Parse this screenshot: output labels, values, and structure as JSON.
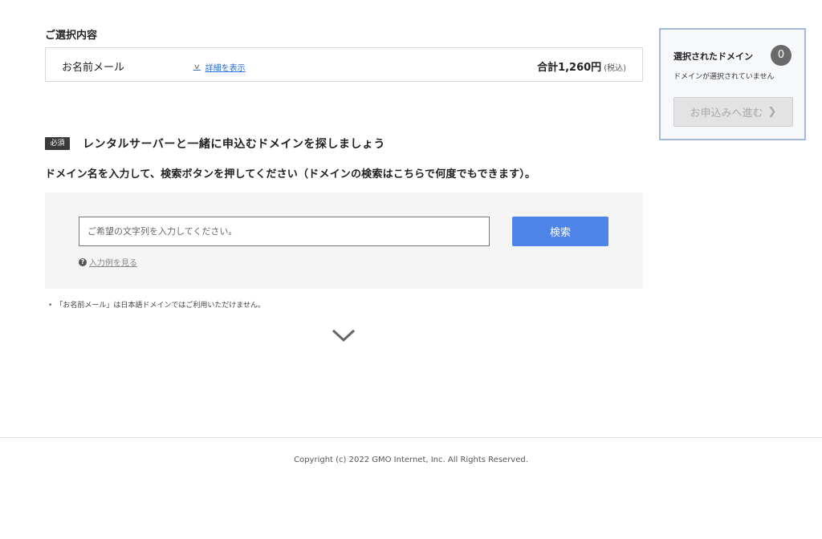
{
  "selection": {
    "title": "ご選択内容",
    "plan_name": "お名前メール",
    "details_link": "詳細を表示",
    "total_label": "合計1,260円",
    "tax_note": "(税込)"
  },
  "domain_section": {
    "required_badge": "必須",
    "heading": "レンタルサーバーと一緒に申込むドメインを探しましょう",
    "instruction": "ドメイン名を入力して、検索ボタンを押してください（ドメインの検索はこちらで何度でもできます）。",
    "search": {
      "placeholder": "ご希望の文字列を入力してください。",
      "value": "",
      "button_label": "検索"
    },
    "example_link": "入力例を見る",
    "note": "「お名前メール」は日本語ドメインではご利用いただけません。"
  },
  "side_panel": {
    "title": "選択されたドメイン",
    "count": "0",
    "status": "ドメインが選択されていません",
    "proceed_label": "お申込みへ進む",
    "proceed_arrow": "❯"
  },
  "footer": {
    "copyright": "Copyright (c) 2022 GMO Internet, Inc. All Rights Reserved."
  },
  "icons": {
    "details_chevron": "chevron-down-icon",
    "example_help": "question-circle-icon",
    "scroll_down": "chevron-down-icon"
  },
  "colors": {
    "search_button": "#4f84e9",
    "link": "#2e6fd6",
    "side_panel_border": "#a4b8e0",
    "required_badge": "#3a3a3a"
  }
}
